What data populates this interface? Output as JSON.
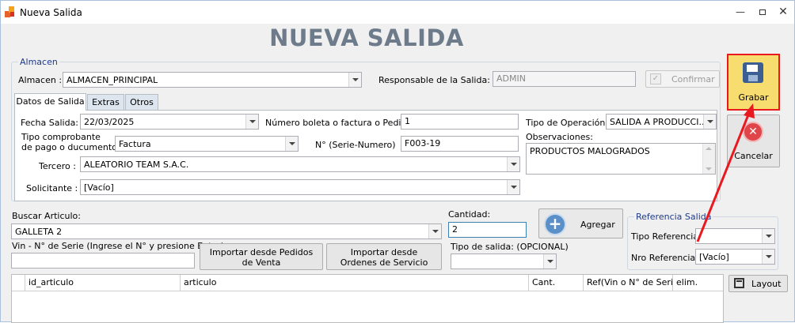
{
  "window": {
    "title": "Nueva Salida"
  },
  "header": {
    "title": "NUEVA SALIDA"
  },
  "almacen_group": {
    "title": "Almacen",
    "almacen_label": "Almacen :",
    "almacen_value": "ALMACEN_PRINCIPAL",
    "responsable_label": "Responsable de la Salida:",
    "responsable_value": "ADMIN",
    "confirm_label": "Confirmar"
  },
  "tabs": [
    {
      "label": "Datos de Salida"
    },
    {
      "label": "Extras"
    },
    {
      "label": "Otros"
    }
  ],
  "datos": {
    "fecha_label": "Fecha Salida:",
    "fecha_value": "22/03/2025",
    "numero_label": "Número boleta o factura o Pedido",
    "numero_value": "1",
    "tipo_operacion_label": "Tipo de Operación:",
    "tipo_operacion_value": "SALIDA A PRODUCCI...",
    "tipo_comprobante_label_1": "Tipo comprobante",
    "tipo_comprobante_label_2": "de pago o ducumento :",
    "tipo_comprobante_value": "Factura",
    "serie_label": "N° (Serie-Numero)",
    "serie_value": "F003-19",
    "observaciones_label": "Observaciones:",
    "observaciones_value": "PRODUCTOS MALOGRADOS",
    "tercero_label": "Tercero :",
    "tercero_value": "ALEATORIO TEAM S.A.C.",
    "solicitante_label": "Solicitante :",
    "solicitante_value": "[Vacío]"
  },
  "articulo": {
    "buscar_label": "Buscar Articulo:",
    "buscar_value": "GALLETA 2",
    "cantidad_label": "Cantidad:",
    "cantidad_value": "2",
    "agregar_label": "Agregar",
    "vin_label": "Vin - N° de Serie (Ingrese el N° y presione Enter)",
    "vin_value": "",
    "import_pedidos_label": "Importar desde Pedidos de Venta",
    "import_ordenes_label": "Importar desde Ordenes de Servicio",
    "tipo_salida_label": "Tipo de salida: (OPCIONAL)",
    "tipo_salida_value": ""
  },
  "referencia": {
    "title": "Referencia Salida",
    "tipo_label": "Tipo Referencia",
    "tipo_value": "",
    "nro_label": "Nro Referencia",
    "nro_value": "[Vacío]"
  },
  "grid": {
    "columns": [
      "id_articulo",
      "articulo",
      "Cant.",
      "Ref(Vin o N° de Seri...",
      "elim."
    ]
  },
  "actions": {
    "grabar_label": "Grabar",
    "cancelar_label": "Cancelar",
    "layout_label": "Layout"
  },
  "colors": {
    "highlight": "#e8191f",
    "accent": "#3c7fb1",
    "title": "#6e7b8a"
  }
}
